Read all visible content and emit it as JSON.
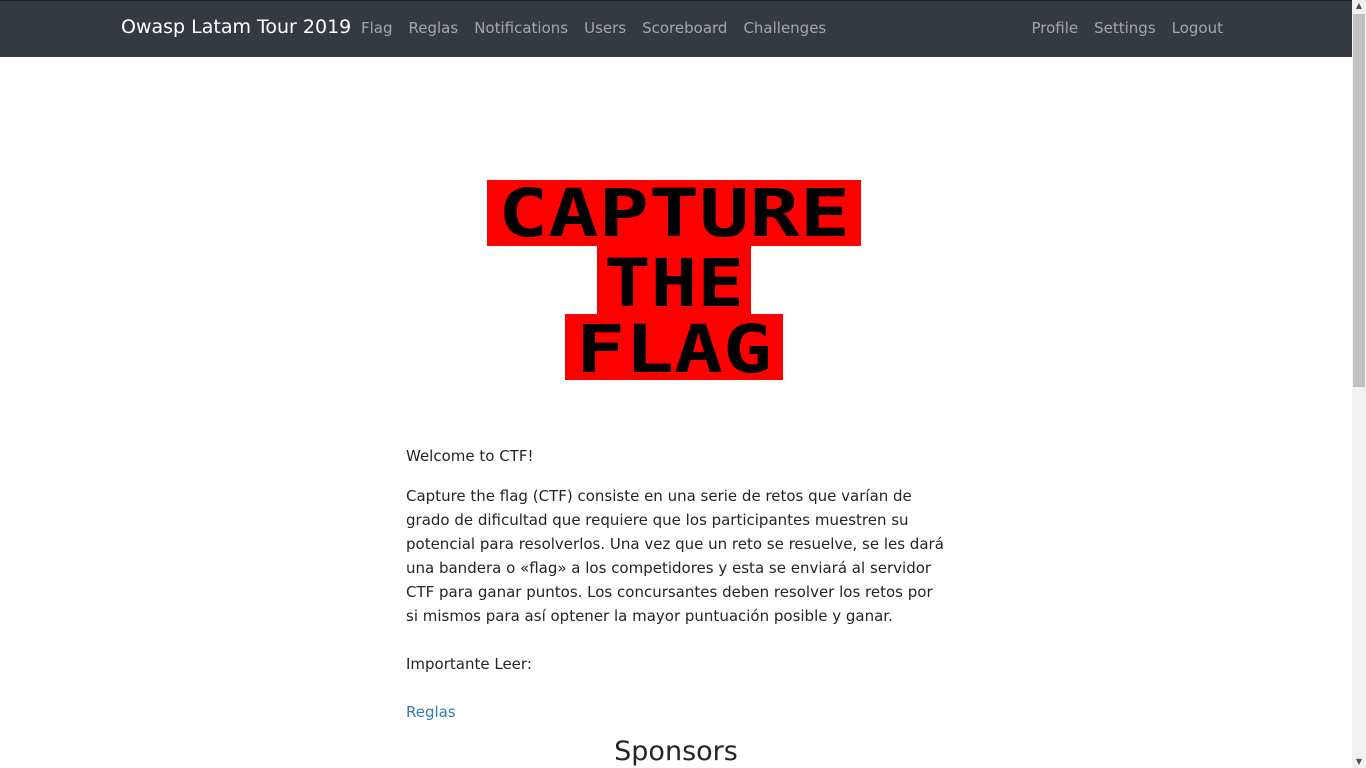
{
  "navbar": {
    "brand": "Owasp Latam Tour 2019",
    "left_links": [
      "Flag",
      "Reglas",
      "Notifications",
      "Users",
      "Scoreboard",
      "Challenges"
    ],
    "right_links": [
      "Profile",
      "Settings",
      "Logout"
    ]
  },
  "logo": {
    "line1": "CAPTURE",
    "line2": "THE",
    "line3": "FLAG",
    "colors": {
      "background": "#ff0000",
      "text": "#000000"
    }
  },
  "content": {
    "welcome": "Welcome to CTF!",
    "description": "Capture the flag (CTF) consiste en una serie de retos que varían de grado de dificultad que requiere que los participantes muestren su potencial para resolverlos. Una vez que un reto se resuelve, se les dará una bandera o «flag» a los competidores y esta se enviará al servidor CTF para ganar puntos. Los concursantes deben resolver los retos por si mismos para así optener la mayor puntuación posible y ganar.",
    "important": "Importante Leer:",
    "rules_link": "Reglas"
  },
  "sponsors_heading": "Sponsors",
  "colors": {
    "navbar_bg": "#343a40",
    "link": "#337ab7"
  }
}
